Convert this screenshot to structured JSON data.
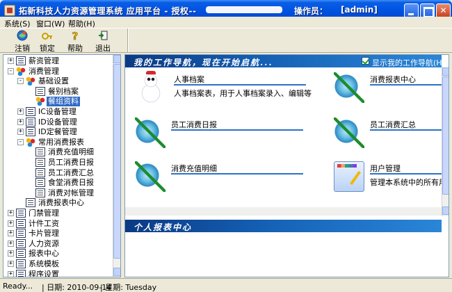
{
  "window": {
    "title": "拓新科技人力资源管理系统  应用平台  -  授权--",
    "operator_label": "操作员：",
    "operator_value": "[admin]"
  },
  "menu": [
    {
      "label": "系统(S)"
    },
    {
      "label": "窗口(W)"
    },
    {
      "label": "帮助(H)"
    }
  ],
  "toolbar": [
    {
      "label": "注销",
      "icon": "logout-icon"
    },
    {
      "label": "锁定",
      "icon": "lock-icon"
    },
    {
      "label": "帮助",
      "icon": "help-icon"
    },
    {
      "label": "退出",
      "icon": "exit-icon"
    }
  ],
  "tree": {
    "nodes": [
      {
        "label": "薪资管理",
        "level": 0,
        "expander": "+",
        "icon": "system-icon"
      },
      {
        "label": "消费管理",
        "level": 0,
        "expander": "-",
        "icon": "balls-icon"
      },
      {
        "label": "基础设置",
        "level": 1,
        "expander": "-",
        "icon": "balls-icon"
      },
      {
        "label": "餐别档案",
        "level": 2,
        "expander": "",
        "icon": "document-icon"
      },
      {
        "label": "餐组资料",
        "level": 2,
        "expander": "",
        "icon": "balls-icon",
        "selected": true
      },
      {
        "label": "IC设备管理",
        "level": 1,
        "expander": "+",
        "icon": "system-icon"
      },
      {
        "label": "ID设备管理",
        "level": 1,
        "expander": "+",
        "icon": "system-icon"
      },
      {
        "label": "ID定餐管理",
        "level": 1,
        "expander": "+",
        "icon": "system-icon"
      },
      {
        "label": "常用消费报表",
        "level": 1,
        "expander": "-",
        "icon": "balls-icon"
      },
      {
        "label": "消费充值明细",
        "level": 2,
        "expander": "",
        "icon": "document-icon"
      },
      {
        "label": "员工消费日报",
        "level": 2,
        "expander": "",
        "icon": "document-icon"
      },
      {
        "label": "员工消费汇总",
        "level": 2,
        "expander": "",
        "icon": "document-icon"
      },
      {
        "label": "食堂消费日报",
        "level": 2,
        "expander": "",
        "icon": "document-icon"
      },
      {
        "label": "消费对帐管理",
        "level": 2,
        "expander": "",
        "icon": "document-icon"
      },
      {
        "label": "消费报表中心",
        "level": 1,
        "expander": "",
        "icon": "document-icon"
      },
      {
        "label": "门禁管理",
        "level": 0,
        "expander": "+",
        "icon": "system-icon"
      },
      {
        "label": "计件工资",
        "level": 0,
        "expander": "+",
        "icon": "system-icon"
      },
      {
        "label": "卡片管理",
        "level": 0,
        "expander": "+",
        "icon": "system-icon"
      },
      {
        "label": "人力资源",
        "level": 0,
        "expander": "+",
        "icon": "system-icon"
      },
      {
        "label": "报表中心",
        "level": 0,
        "expander": "+",
        "icon": "system-icon"
      },
      {
        "label": "系统模板",
        "level": 0,
        "expander": "+",
        "icon": "system-icon"
      },
      {
        "label": "程序设置",
        "level": 0,
        "expander": "+",
        "icon": "system-icon"
      }
    ]
  },
  "nav": {
    "title": "我的工作导航，现在开始启航...",
    "show_label": "显示我的工作导航(H)",
    "show_checked": true,
    "cards": [
      {
        "title": "人事档案",
        "desc": "人事档案表，用于人事档案录入、编辑等",
        "icon": "snowman-icon"
      },
      {
        "title": "消费报表中心",
        "desc": "",
        "icon": "globe-icon"
      },
      {
        "title": "员工消费日报",
        "desc": "",
        "icon": "globe-icon"
      },
      {
        "title": "员工消费汇总",
        "desc": "",
        "icon": "globe-icon"
      },
      {
        "title": "消费充值明细",
        "desc": "",
        "icon": "globe-icon"
      },
      {
        "title": "用户管理",
        "desc": "管理本系统中的所有用",
        "icon": "palette-icon"
      }
    ]
  },
  "report": {
    "title": "个人报表中心"
  },
  "status": {
    "ready": "Ready...",
    "date": "| 日期: 2010-09-14",
    "weekday": "| 星期: Tuesday"
  }
}
